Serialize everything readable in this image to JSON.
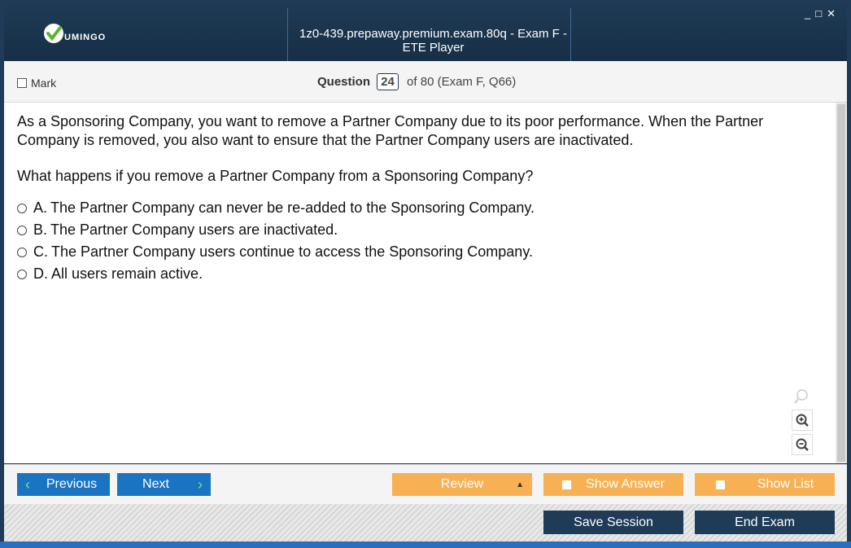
{
  "window": {
    "title": "1z0-439.prepaway.premium.exam.80q - Exam F - ETE Player",
    "brand": "UMINGO",
    "controls": [
      "_",
      "□",
      "✕"
    ]
  },
  "header": {
    "mark_label": "Mark",
    "question_label": "Question",
    "question_number": "24",
    "question_suffix": "of 80 (Exam F, Q66)"
  },
  "question": {
    "text": "As a Sponsoring Company, you want to remove a Partner Company due to its poor performance. When the Partner Company is removed, you also want to ensure that the Partner Company users are inactivated.",
    "prompt": "What happens if you remove a Partner Company from a Sponsoring Company?",
    "options": [
      {
        "letter": "A.",
        "text": "The Partner Company can never be re-added to the Sponsoring Company."
      },
      {
        "letter": "B.",
        "text": "The Partner Company users are inactivated."
      },
      {
        "letter": "C.",
        "text": "The Partner Company users continue to access the Sponsoring Company."
      },
      {
        "letter": "D.",
        "text": "All users remain active."
      }
    ]
  },
  "nav": {
    "previous": "Previous",
    "next": "Next",
    "review": "Review",
    "show_answer": "Show Answer",
    "show_list": "Show List",
    "save_session": "Save Session",
    "end_exam": "End Exam"
  },
  "colors": {
    "titlebar": "#1f3b57",
    "nav_blue": "#1b74c2",
    "orange": "#f8b054",
    "dark_button": "#1f3b57"
  }
}
